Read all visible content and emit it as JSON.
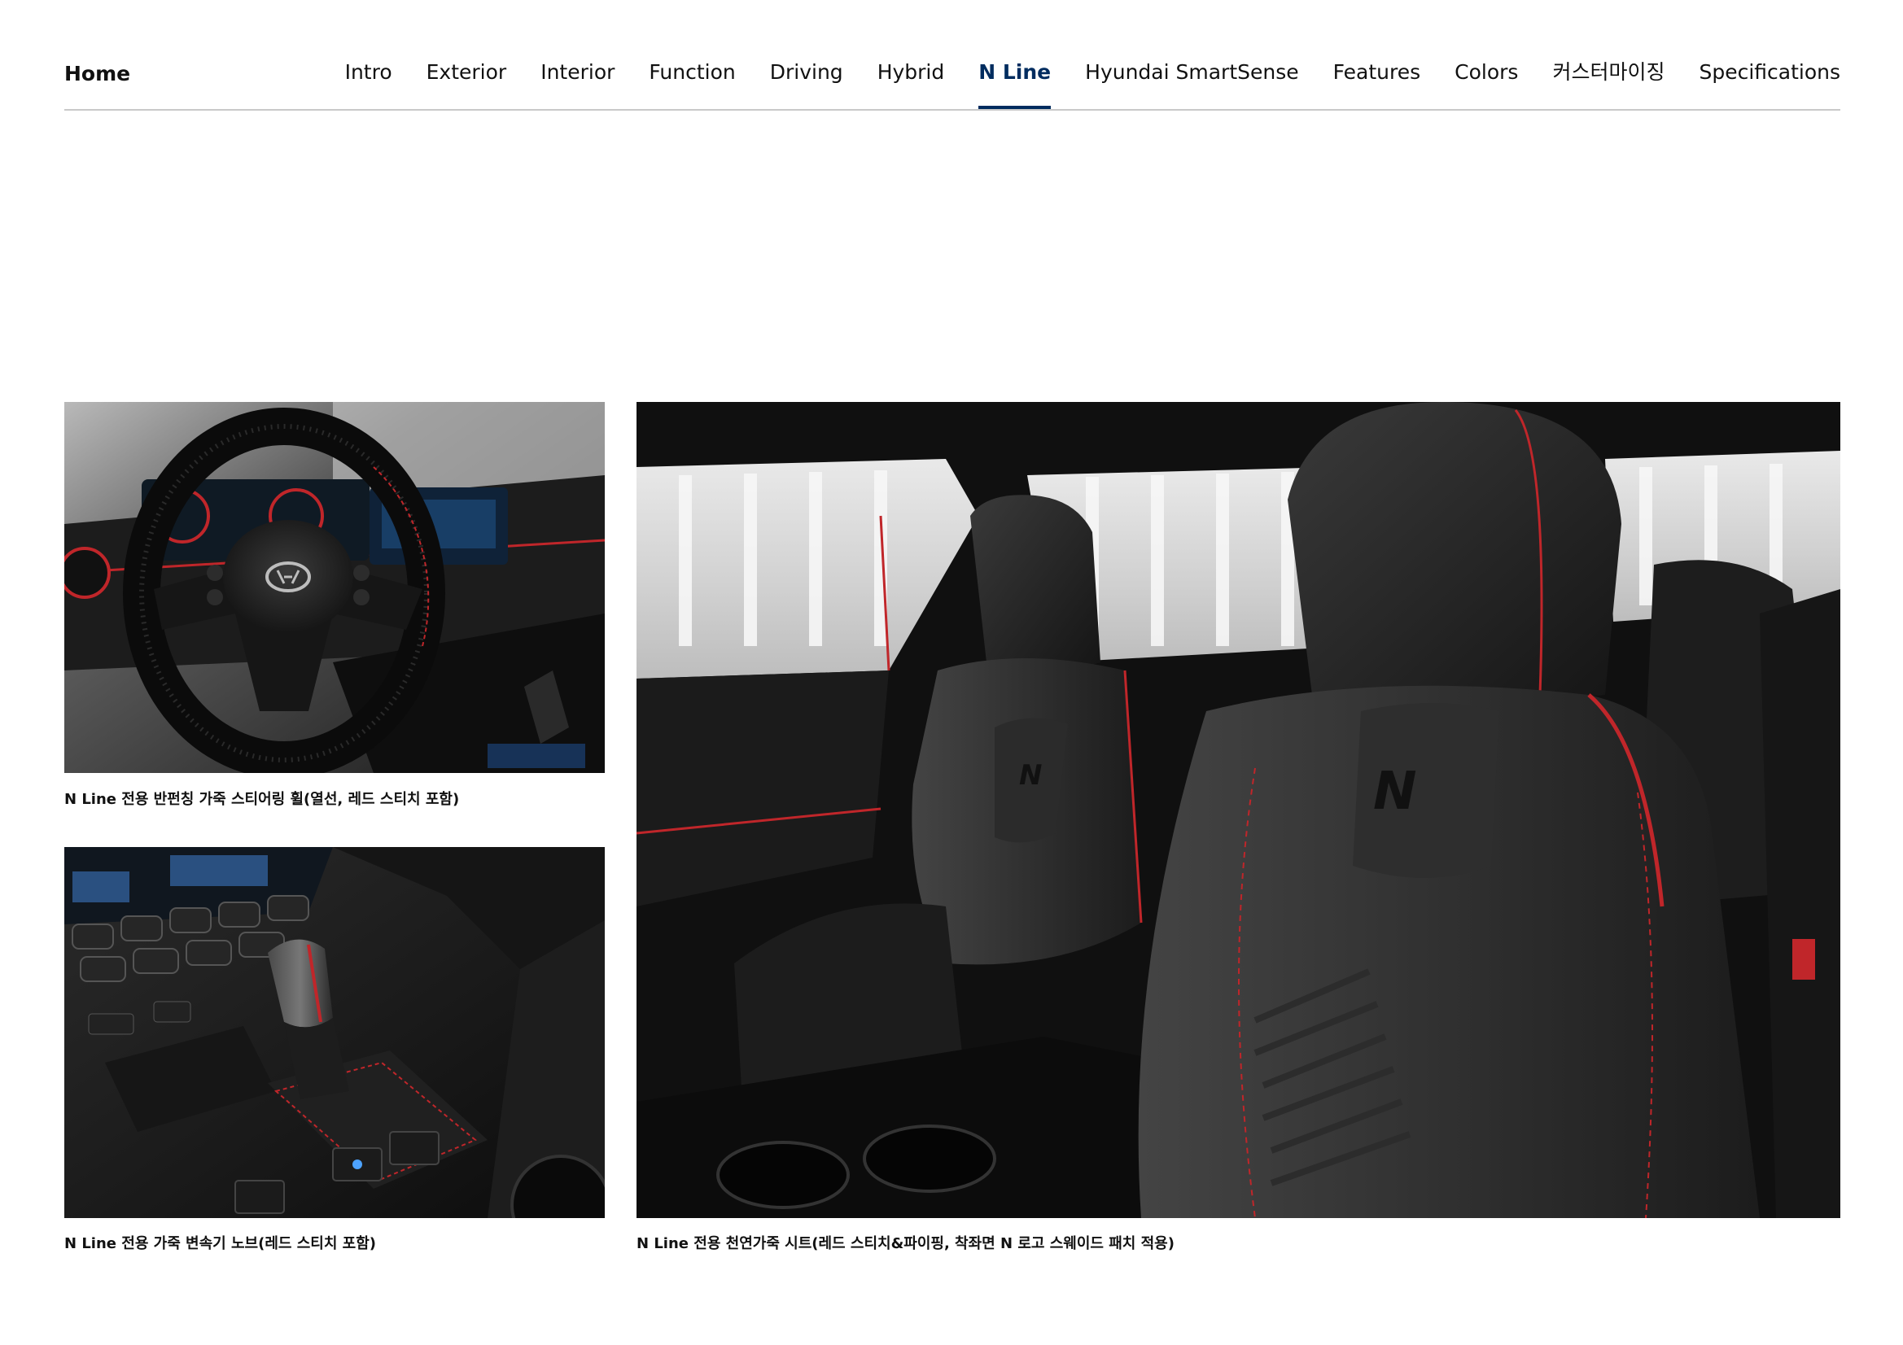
{
  "header": {
    "home_label": "Home",
    "nav": [
      {
        "label": "Intro",
        "active": false
      },
      {
        "label": "Exterior",
        "active": false
      },
      {
        "label": "Interior",
        "active": false
      },
      {
        "label": "Function",
        "active": false
      },
      {
        "label": "Driving",
        "active": false
      },
      {
        "label": "Hybrid",
        "active": false
      },
      {
        "label": "N Line",
        "active": true
      },
      {
        "label": "Hyundai SmartSense",
        "active": false
      },
      {
        "label": "Features",
        "active": false
      },
      {
        "label": "Colors",
        "active": false
      },
      {
        "label": "커스터마이징",
        "active": false
      },
      {
        "label": "Specifications",
        "active": false
      }
    ]
  },
  "theme": {
    "accent": "#002c5f",
    "divider": "#c9c9c9",
    "stitch_red": "#d32a2a"
  },
  "gallery": {
    "steering_wheel": {
      "caption": "N Line 전용 반펀칭 가죽 스티어링 휠(열선, 레드 스티치 포함)"
    },
    "shift_knob": {
      "caption": "N Line 전용 가죽 변속기 노브(레드 스티치 포함)"
    },
    "seats": {
      "caption": "N Line 전용 천연가죽 시트(레드 스티치&파이핑, 착좌면 N 로고 스웨이드 패치 적용)"
    }
  }
}
